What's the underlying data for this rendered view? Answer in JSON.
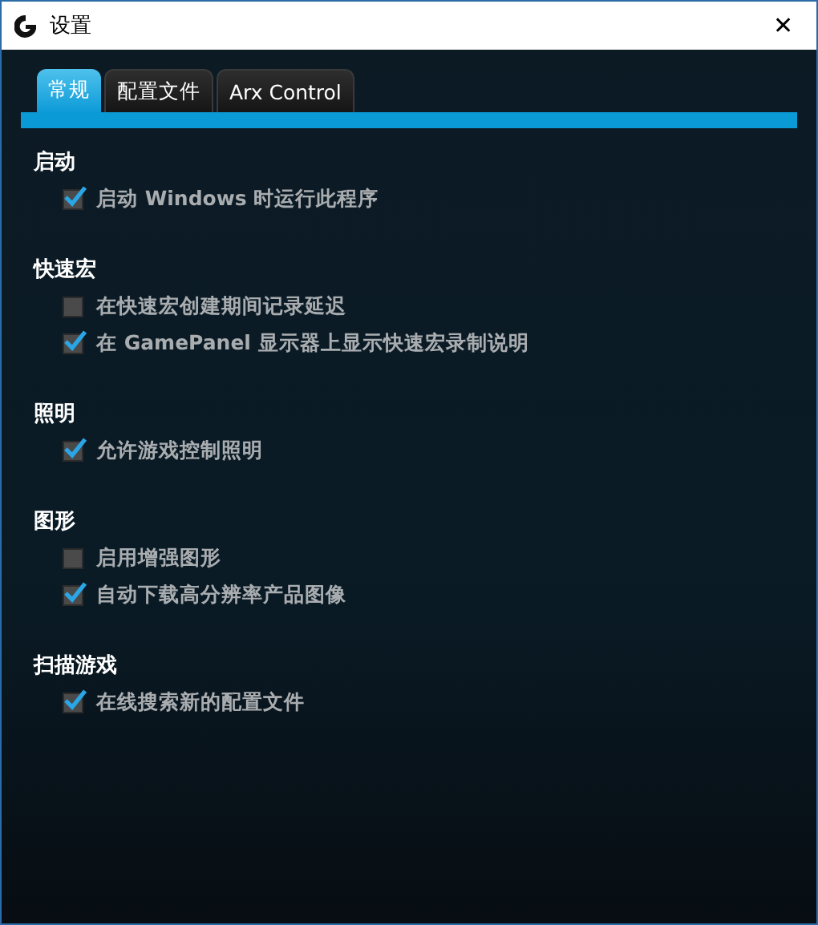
{
  "window": {
    "title": "设置",
    "close": "✕"
  },
  "tabs": [
    {
      "label": "常规",
      "selected": true
    },
    {
      "label": "配置文件",
      "selected": false
    },
    {
      "label": "Arx Control",
      "selected": false
    }
  ],
  "sections": [
    {
      "title": "启动",
      "options": [
        {
          "label": "启动 Windows 时运行此程序",
          "checked": true
        }
      ]
    },
    {
      "title": "快速宏",
      "options": [
        {
          "label": "在快速宏创建期间记录延迟",
          "checked": false
        },
        {
          "label": "在 GamePanel 显示器上显示快速宏录制说明",
          "checked": true
        }
      ]
    },
    {
      "title": "照明",
      "options": [
        {
          "label": "允许游戏控制照明",
          "checked": true
        }
      ]
    },
    {
      "title": "图形",
      "options": [
        {
          "label": "启用增强图形",
          "checked": false
        },
        {
          "label": "自动下载高分辨率产品图像",
          "checked": true
        }
      ]
    },
    {
      "title": "扫描游戏",
      "options": [
        {
          "label": "在线搜索新的配置文件",
          "checked": true
        }
      ]
    }
  ]
}
